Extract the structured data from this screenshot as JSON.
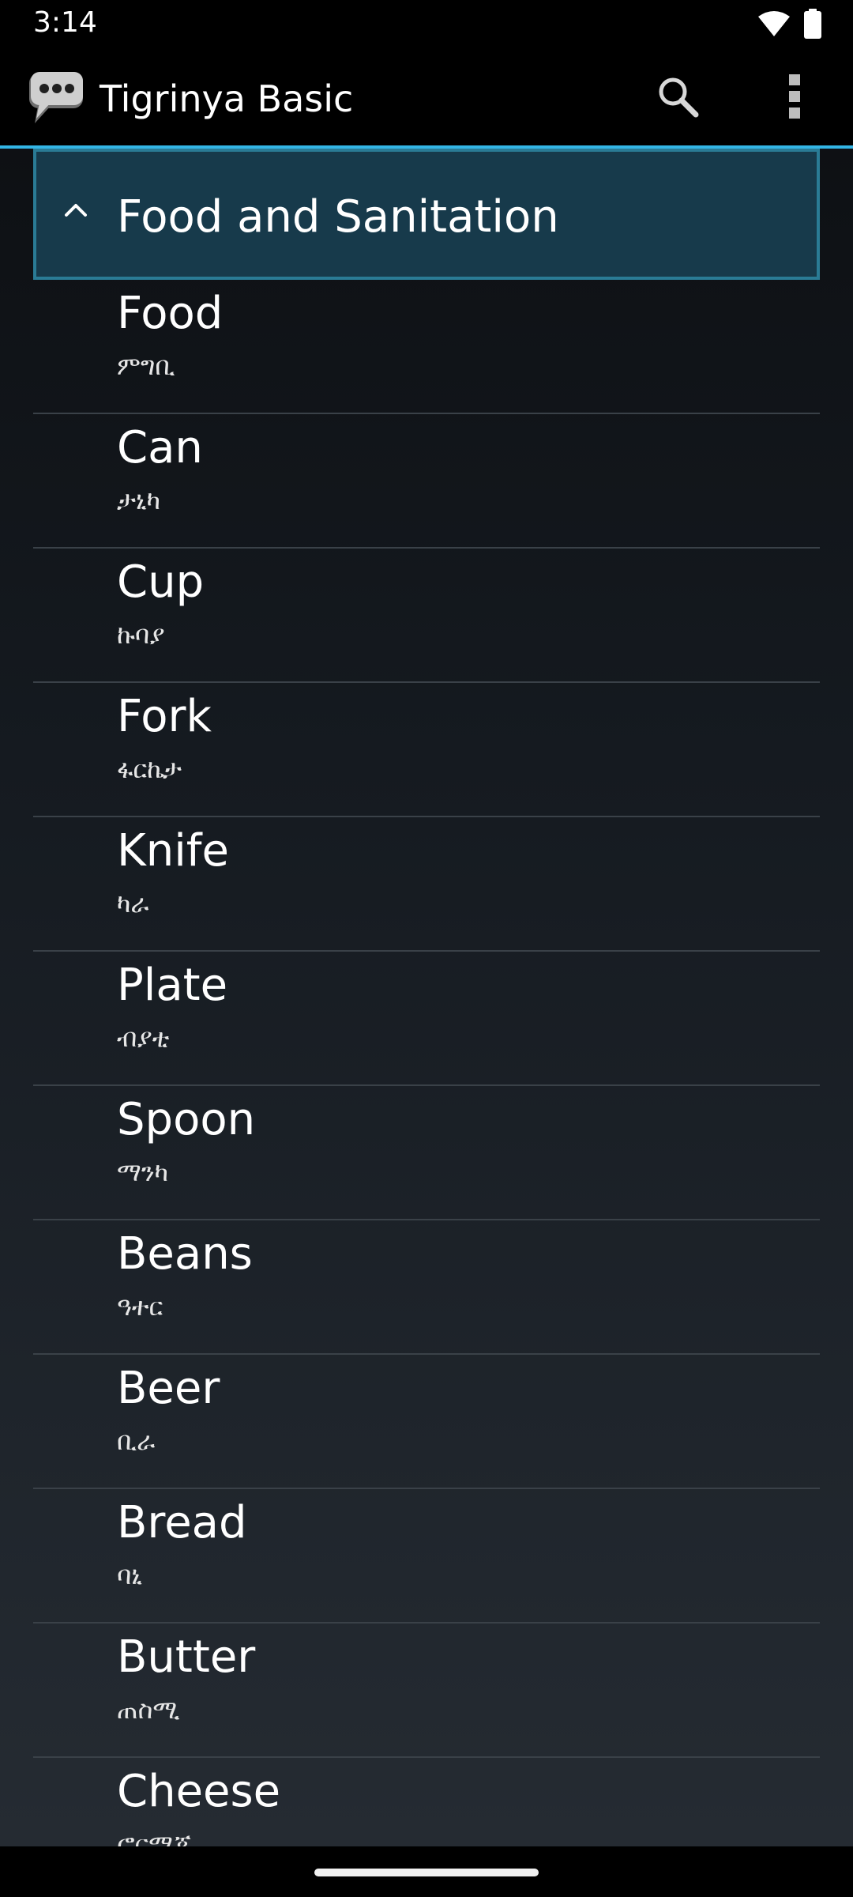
{
  "status_bar": {
    "time": "3:14",
    "icons": [
      "wifi-icon",
      "battery-icon"
    ]
  },
  "app_bar": {
    "app_icon": "speech-bubble-icon",
    "title": "Tigrinya Basic",
    "actions": [
      "search-icon",
      "overflow-menu-icon"
    ]
  },
  "group": {
    "title": "Food and Sanitation",
    "expanded": true,
    "indicator_icon": "chevron-up-icon"
  },
  "items": [
    {
      "english": "Food",
      "tigrinya": "ምግቢ"
    },
    {
      "english": "Can",
      "tigrinya": "ታኒካ"
    },
    {
      "english": "Cup",
      "tigrinya": "ኩባያ"
    },
    {
      "english": "Fork",
      "tigrinya": "ፋርኬታ"
    },
    {
      "english": "Knife",
      "tigrinya": "ካራ"
    },
    {
      "english": "Plate",
      "tigrinya": "ብያቲ"
    },
    {
      "english": "Spoon",
      "tigrinya": "ማንካ"
    },
    {
      "english": "Beans",
      "tigrinya": "ዓተር"
    },
    {
      "english": "Beer",
      "tigrinya": "ቢራ"
    },
    {
      "english": "Bread",
      "tigrinya": "ባኒ"
    },
    {
      "english": "Butter",
      "tigrinya": "ጠስሚ"
    },
    {
      "english": "Cheese",
      "tigrinya": "ፎርማጆ"
    }
  ],
  "colors": {
    "accent": "#33b5e5",
    "group_header_bg": "#173a4b",
    "group_header_border": "#2a7b95",
    "divider": "#3a4148"
  }
}
